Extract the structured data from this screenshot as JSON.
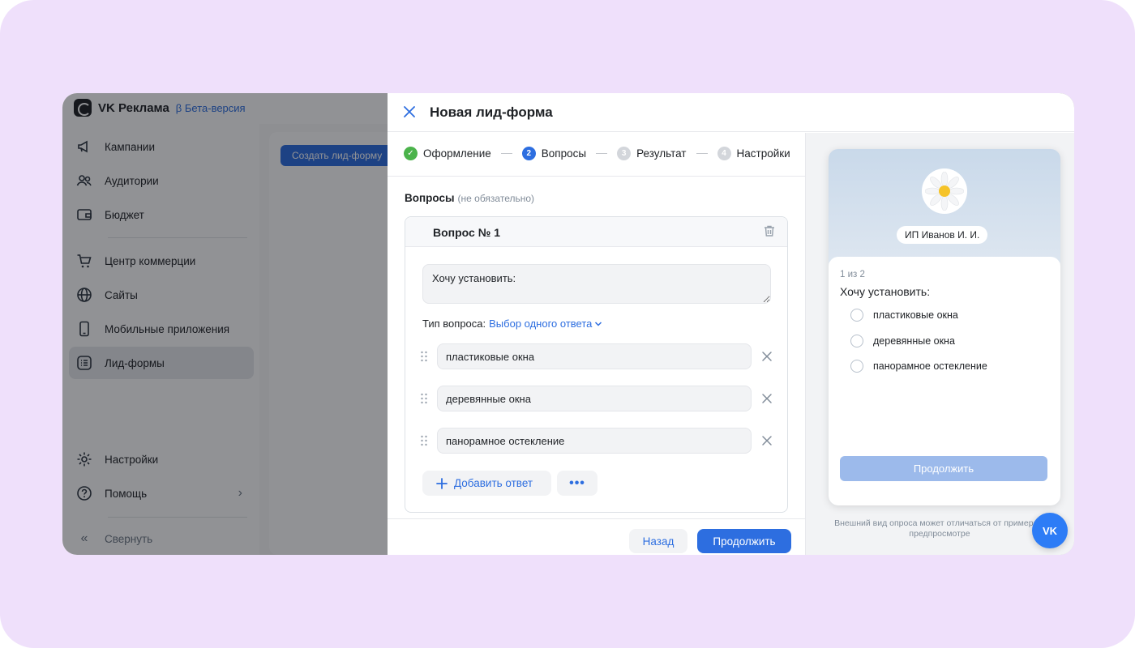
{
  "background_app": {
    "brand": "VK Реклама",
    "beta_label": "β Бета-версия",
    "create_button": "Создать лид-форму",
    "nav": [
      {
        "label": "Кампании",
        "icon": "megaphone-icon"
      },
      {
        "label": "Аудитории",
        "icon": "users-icon"
      },
      {
        "label": "Бюджет",
        "icon": "wallet-icon"
      },
      {
        "label": "Центр коммерции",
        "icon": "cart-icon"
      },
      {
        "label": "Сайты",
        "icon": "globe-icon"
      },
      {
        "label": "Мобильные приложения",
        "icon": "phone-icon"
      },
      {
        "label": "Лид-формы",
        "icon": "list-icon"
      },
      {
        "label": "Настройки",
        "icon": "gear-icon"
      },
      {
        "label": "Помощь",
        "icon": "help-icon"
      },
      {
        "label": "Свернуть",
        "icon": "collapse-icon"
      }
    ],
    "active_nav": "Лид-формы"
  },
  "modal": {
    "title": "Новая лид-форма",
    "steps": [
      {
        "num": "✓",
        "label": "Оформление",
        "state": "done"
      },
      {
        "num": "2",
        "label": "Вопросы",
        "state": "active"
      },
      {
        "num": "3",
        "label": "Результат",
        "state": "inactive"
      },
      {
        "num": "4",
        "label": "Настройки",
        "state": "inactive"
      }
    ],
    "section_title": "Вопросы",
    "section_note": "(не обязательно)",
    "question": {
      "title": "Вопрос № 1",
      "text": "Хочу установить:",
      "type_label": "Тип вопроса:",
      "type_value": "Выбор одного ответа",
      "answers": [
        "пластиковые окна",
        "деревянные окна",
        "панорамное остекление"
      ],
      "add_answer": "Добавить ответ",
      "more": "•••"
    },
    "back_button": "Назад",
    "next_button": "Продолжить"
  },
  "preview": {
    "org_name": "ИП Иванов И. И.",
    "counter": "1 из 2",
    "question": "Хочу установить:",
    "options": [
      "пластиковые окна",
      "деревянные окна",
      "панорамное остекление"
    ],
    "continue_button": "Продолжить",
    "note": "Внешний вид опроса может отличаться от примера в предпросмотре"
  },
  "vk_button": "VK",
  "colors": {
    "accent": "#2d6ee0",
    "success": "#4bb34b",
    "page_bg": "#efe0fb"
  }
}
